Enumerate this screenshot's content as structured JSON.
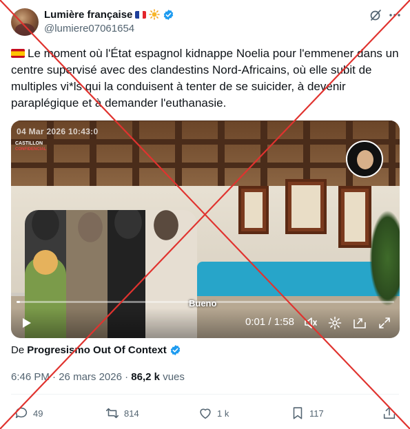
{
  "author": {
    "display_name": "Lumière française",
    "handle": "@lumiere07061654",
    "flag_icon": "flag-france-icon",
    "emoji_icon": "sun-icon"
  },
  "tweet": {
    "text": "Le moment où l'État espagnol kidnappe Noelia pour l'emmener dans un centre supervisé avec des clandestins Nord-Africains, où elle subit de multiples vi*ls qui la conduisent à tenter de se suicider, à devenir paraplégique et à demander l'euthanasie.",
    "lead_icon": "flag-spain-icon"
  },
  "video": {
    "burned_timestamp": "04 Mar 2026 10:43:0",
    "channel_name": "CASTILLON",
    "channel_tag": "CONFIDENCIAL",
    "subtitle": "Bueno",
    "current_time": "0:01",
    "duration": "1:58",
    "progress": 0.01
  },
  "source": {
    "prefix": "De",
    "name": "Progresismo Out Of Context"
  },
  "meta": {
    "time": "6:46 PM",
    "date": "26 mars 2026",
    "views_count": "86,2 k",
    "views_label": "vues"
  },
  "actions": {
    "replies": "49",
    "reposts": "814",
    "likes": "1 k",
    "bookmarks": "117"
  },
  "colors": {
    "verified": "#1d9bf0",
    "overlay_cross": "#e0332f",
    "secondary_text": "#536471"
  }
}
